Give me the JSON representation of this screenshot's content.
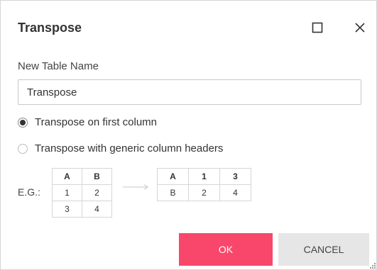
{
  "dialog": {
    "title": "Transpose",
    "maximize_icon": "maximize-icon",
    "close_icon": "close-icon"
  },
  "form": {
    "name_label": "New Table Name",
    "name_value": "Transpose"
  },
  "options": [
    {
      "label": "Transpose on first column",
      "selected": true
    },
    {
      "label": "Transpose with generic column headers",
      "selected": false
    }
  ],
  "example": {
    "label": "E.G.:",
    "source_table": {
      "headers": [
        "A",
        "B"
      ],
      "rows": [
        [
          "1",
          "2"
        ],
        [
          "3",
          "4"
        ]
      ]
    },
    "arrow_icon": "arrow-right-icon",
    "result_table": {
      "headers": [
        "A",
        "1",
        "3"
      ],
      "rows": [
        [
          "B",
          "2",
          "4"
        ]
      ]
    }
  },
  "buttons": {
    "ok": "OK",
    "cancel": "CANCEL"
  },
  "colors": {
    "ok_button": "#f8476a",
    "cancel_button": "#e6e6e6"
  }
}
